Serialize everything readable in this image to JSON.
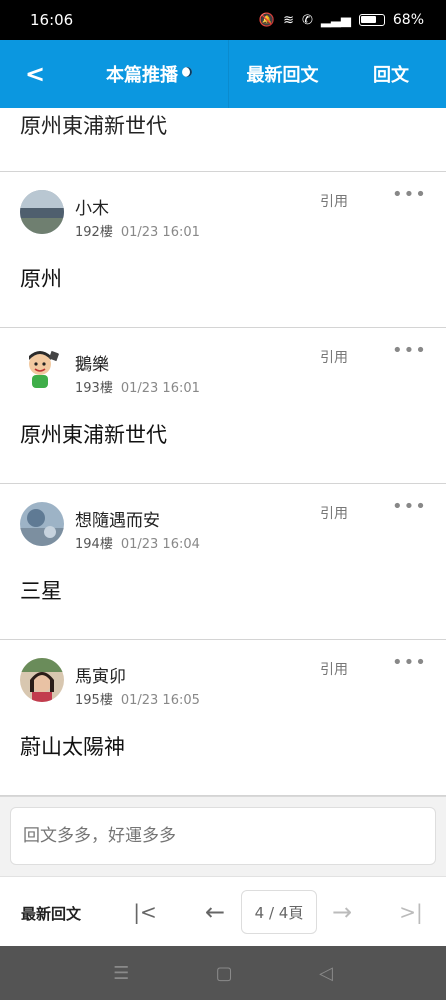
{
  "status_bar": {
    "time": "16:06",
    "icons": [
      "mute-icon",
      "wifi-icon",
      "call-icon",
      "signal-icon",
      "battery-icon"
    ],
    "battery": "68%"
  },
  "header": {
    "back_icon": "chevron-left-icon",
    "tabs": [
      {
        "label": "本篇推播"
      },
      {
        "label": "最新回文"
      },
      {
        "label": "回文"
      }
    ]
  },
  "feed": {
    "partial_text": "原州東浦新世代",
    "posts": [
      {
        "name": "小木",
        "floor": "192樓",
        "time": "01/23 16:01",
        "quote": "引用",
        "more": "•••",
        "content": "原州"
      },
      {
        "name": "鵝樂",
        "floor": "193樓",
        "time": "01/23 16:01",
        "quote": "引用",
        "more": "•••",
        "content": "原州東浦新世代"
      },
      {
        "name": "想隨遇而安",
        "floor": "194樓",
        "time": "01/23 16:04",
        "quote": "引用",
        "more": "•••",
        "content": "三星"
      },
      {
        "name": "馬寅卯",
        "floor": "195樓",
        "time": "01/23 16:05",
        "quote": "引用",
        "more": "•••",
        "content": "蔚山太陽神"
      }
    ]
  },
  "reply": {
    "placeholder": "回文多多，好運多多"
  },
  "pager": {
    "latest_label": "最新回文",
    "page_indicator": "4 / 4頁",
    "first_icon": "first-page-icon",
    "prev_icon": "arrow-left-icon",
    "next_icon": "arrow-right-icon",
    "last_icon": "last-page-icon"
  },
  "colors": {
    "header_bg": "#0b97e0",
    "divider": "#d4d4d4",
    "system_nav_bg": "#545454"
  }
}
